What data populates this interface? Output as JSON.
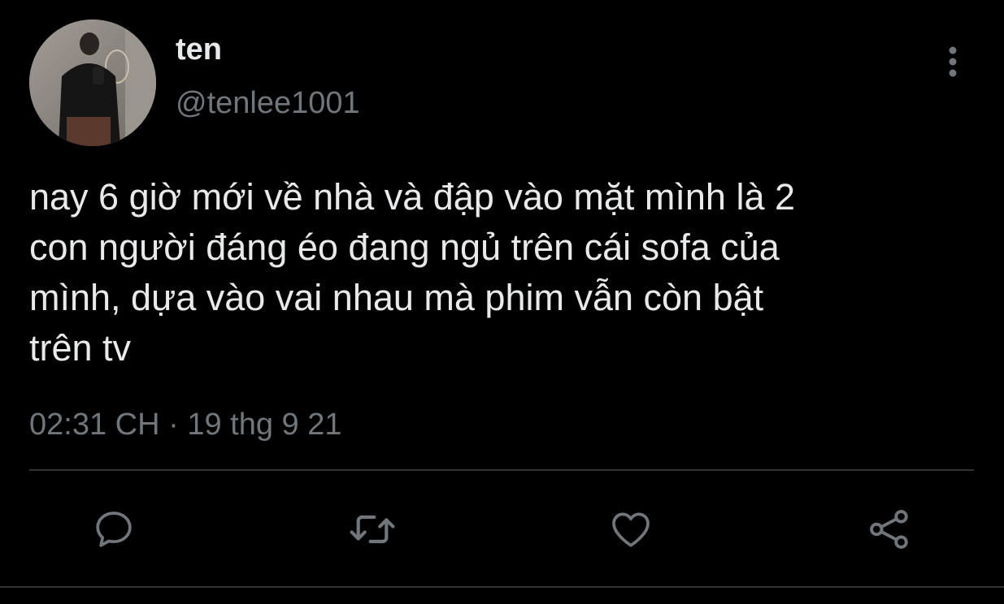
{
  "user": {
    "display_name": "ten",
    "handle": "@tenlee1001"
  },
  "tweet": {
    "text": "nay 6 giờ mới về nhà và đập vào mặt mình là 2\ncon người đáng éo đang ngủ trên cái sofa của\nmình, dựa vào vai nhau mà phim vẫn còn bật\ntrên tv",
    "time": "02:31 CH",
    "separator": "·",
    "date": "19 thg 9 21"
  },
  "icons": {
    "more": "more-vertical-icon",
    "reply": "reply-icon",
    "retweet": "retweet-icon",
    "like": "heart-icon",
    "share": "share-icon"
  },
  "colors": {
    "background": "#000000",
    "primary_text": "#e7e9ea",
    "secondary_text": "#71767b",
    "divider": "#2f3336",
    "icon": "#71767b"
  }
}
